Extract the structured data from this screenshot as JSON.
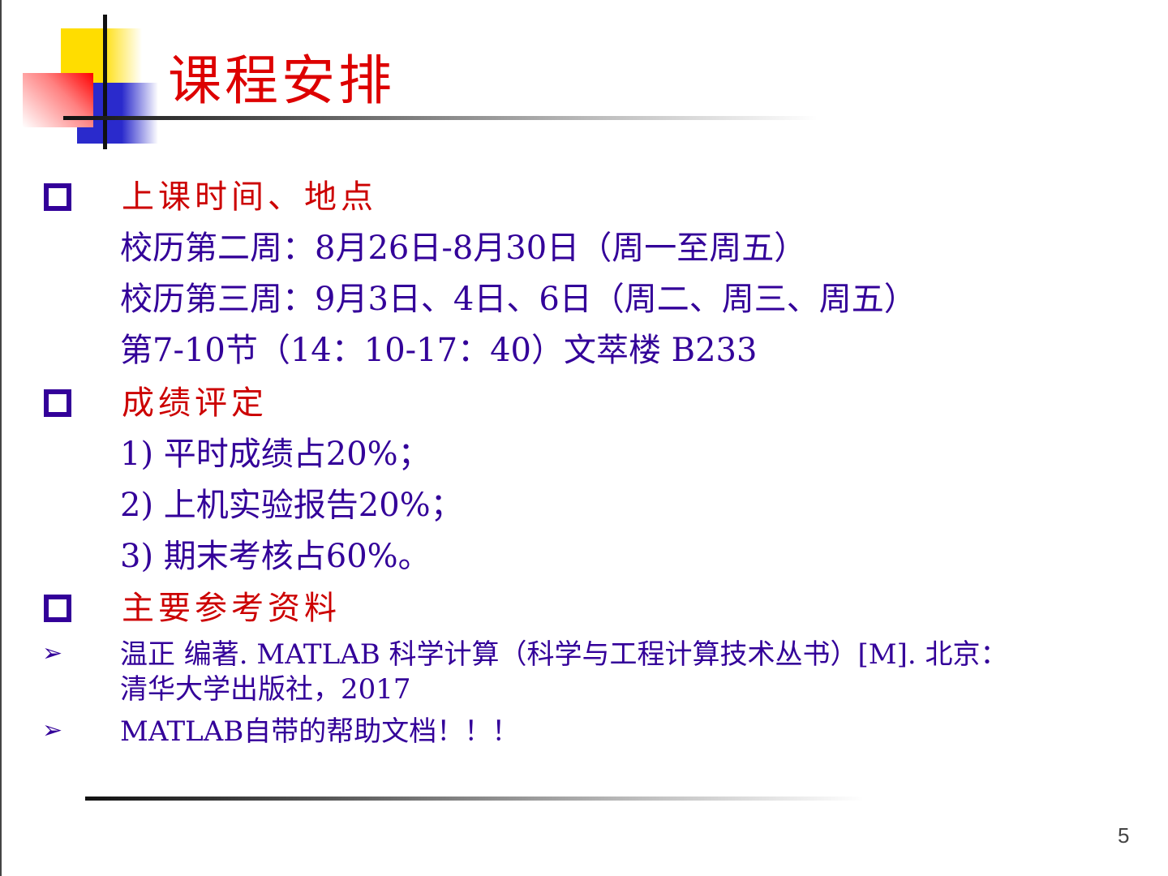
{
  "title": "课程安排",
  "sections": [
    {
      "heading": "上课时间、地点",
      "lines": [
        "校历第二周：8月26日-8月30日（周一至周五）",
        "校历第三周：9月3日、4日、6日（周二、周三、周五）",
        "第7-10节（14：10-17：40）文萃楼 B233"
      ]
    },
    {
      "heading": "成绩评定",
      "lines": [
        "1) 平时成绩占20%；",
        "2) 上机实验报告20%；",
        "3) 期末考核占60%。"
      ]
    },
    {
      "heading": "主要参考资料"
    }
  ],
  "references": [
    "温正 编著. MATLAB 科学计算（科学与工程计算技术丛书）[M]. 北京：",
    "清华大学出版社，2017",
    "MATLAB自带的帮助文档！！！"
  ],
  "page_number": "5"
}
